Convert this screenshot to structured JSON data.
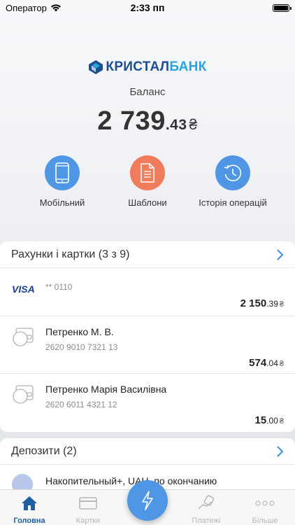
{
  "status_bar": {
    "carrier": "Оператор",
    "time": "2:33 пп"
  },
  "brand": {
    "name_a": "КРИСТАЛ",
    "name_b": "БАНК",
    "color_dark": "#1b4f8f",
    "color_light": "#29a3de"
  },
  "balance": {
    "label": "Баланс",
    "whole": "2 739",
    "cents": ".43",
    "currency": "₴"
  },
  "quick_actions": [
    {
      "label": "Мобільний",
      "icon": "phone-icon",
      "color": "#4f97e4"
    },
    {
      "label": "Шаблони",
      "icon": "document-icon",
      "color": "#f07c5c"
    },
    {
      "label": "Історія операцій",
      "icon": "history-clock-icon",
      "color": "#4f97e4"
    }
  ],
  "accounts": {
    "title": "Рахунки і картки (3 з 9)",
    "items": [
      {
        "brand": "VISA",
        "subtitle": "** 0110",
        "amount_whole": "2 150",
        "amount_cents": ".39",
        "currency": "₴"
      },
      {
        "title": "Петренко М. В.",
        "subtitle": "2620 9010 7321 13",
        "amount_whole": "574",
        "amount_cents": ".04",
        "currency": "₴"
      },
      {
        "title": "Петренко Марія Василівна",
        "subtitle": "2620 6011 4321 12",
        "amount_whole": "15",
        "amount_cents": ".00",
        "currency": "₴"
      }
    ]
  },
  "deposits": {
    "title": "Депозити (2)",
    "items": [
      {
        "title": "Накопительный+, UAH, по окончанию"
      }
    ]
  },
  "tabs": [
    {
      "label": "Головна",
      "icon": "home-icon",
      "active": true
    },
    {
      "label": "Картки",
      "icon": "card-icon",
      "active": false
    },
    {
      "label": "Платежі",
      "icon": "payments-hand-icon",
      "active": false
    },
    {
      "label": "Більше",
      "icon": "more-dots-icon",
      "active": false
    }
  ],
  "fab": {
    "icon": "lightning-icon"
  }
}
